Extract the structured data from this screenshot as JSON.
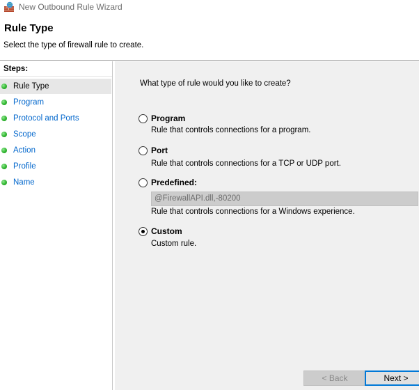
{
  "window": {
    "title": "New Outbound Rule Wizard",
    "icon": "firewall-shield-icon"
  },
  "header": {
    "title": "Rule Type",
    "subtitle": "Select the type of firewall rule to create."
  },
  "sidebar": {
    "steps_label": "Steps:",
    "items": [
      {
        "label": "Rule Type",
        "active": true
      },
      {
        "label": "Program",
        "active": false
      },
      {
        "label": "Protocol and Ports",
        "active": false
      },
      {
        "label": "Scope",
        "active": false
      },
      {
        "label": "Action",
        "active": false
      },
      {
        "label": "Profile",
        "active": false
      },
      {
        "label": "Name",
        "active": false
      }
    ]
  },
  "main": {
    "question": "What type of rule would you like to create?",
    "options": [
      {
        "label": "Program",
        "description": "Rule that controls connections for a program.",
        "checked": false
      },
      {
        "label": "Port",
        "description": "Rule that controls connections for a TCP or UDP port.",
        "checked": false
      },
      {
        "label": "Predefined:",
        "description": "Rule that controls connections for a Windows experience.",
        "checked": false
      },
      {
        "label": "Custom",
        "description": "Custom rule.",
        "checked": true
      }
    ],
    "predefined_value": "@FirewallAPI.dll,-80200"
  },
  "buttons": {
    "back": "< Back",
    "next": "Next >"
  },
  "colors": {
    "link": "#0066cc",
    "panel_bg": "#f0f0f0",
    "accent_border": "#0078d7",
    "step_dot": "#2fb52f"
  }
}
